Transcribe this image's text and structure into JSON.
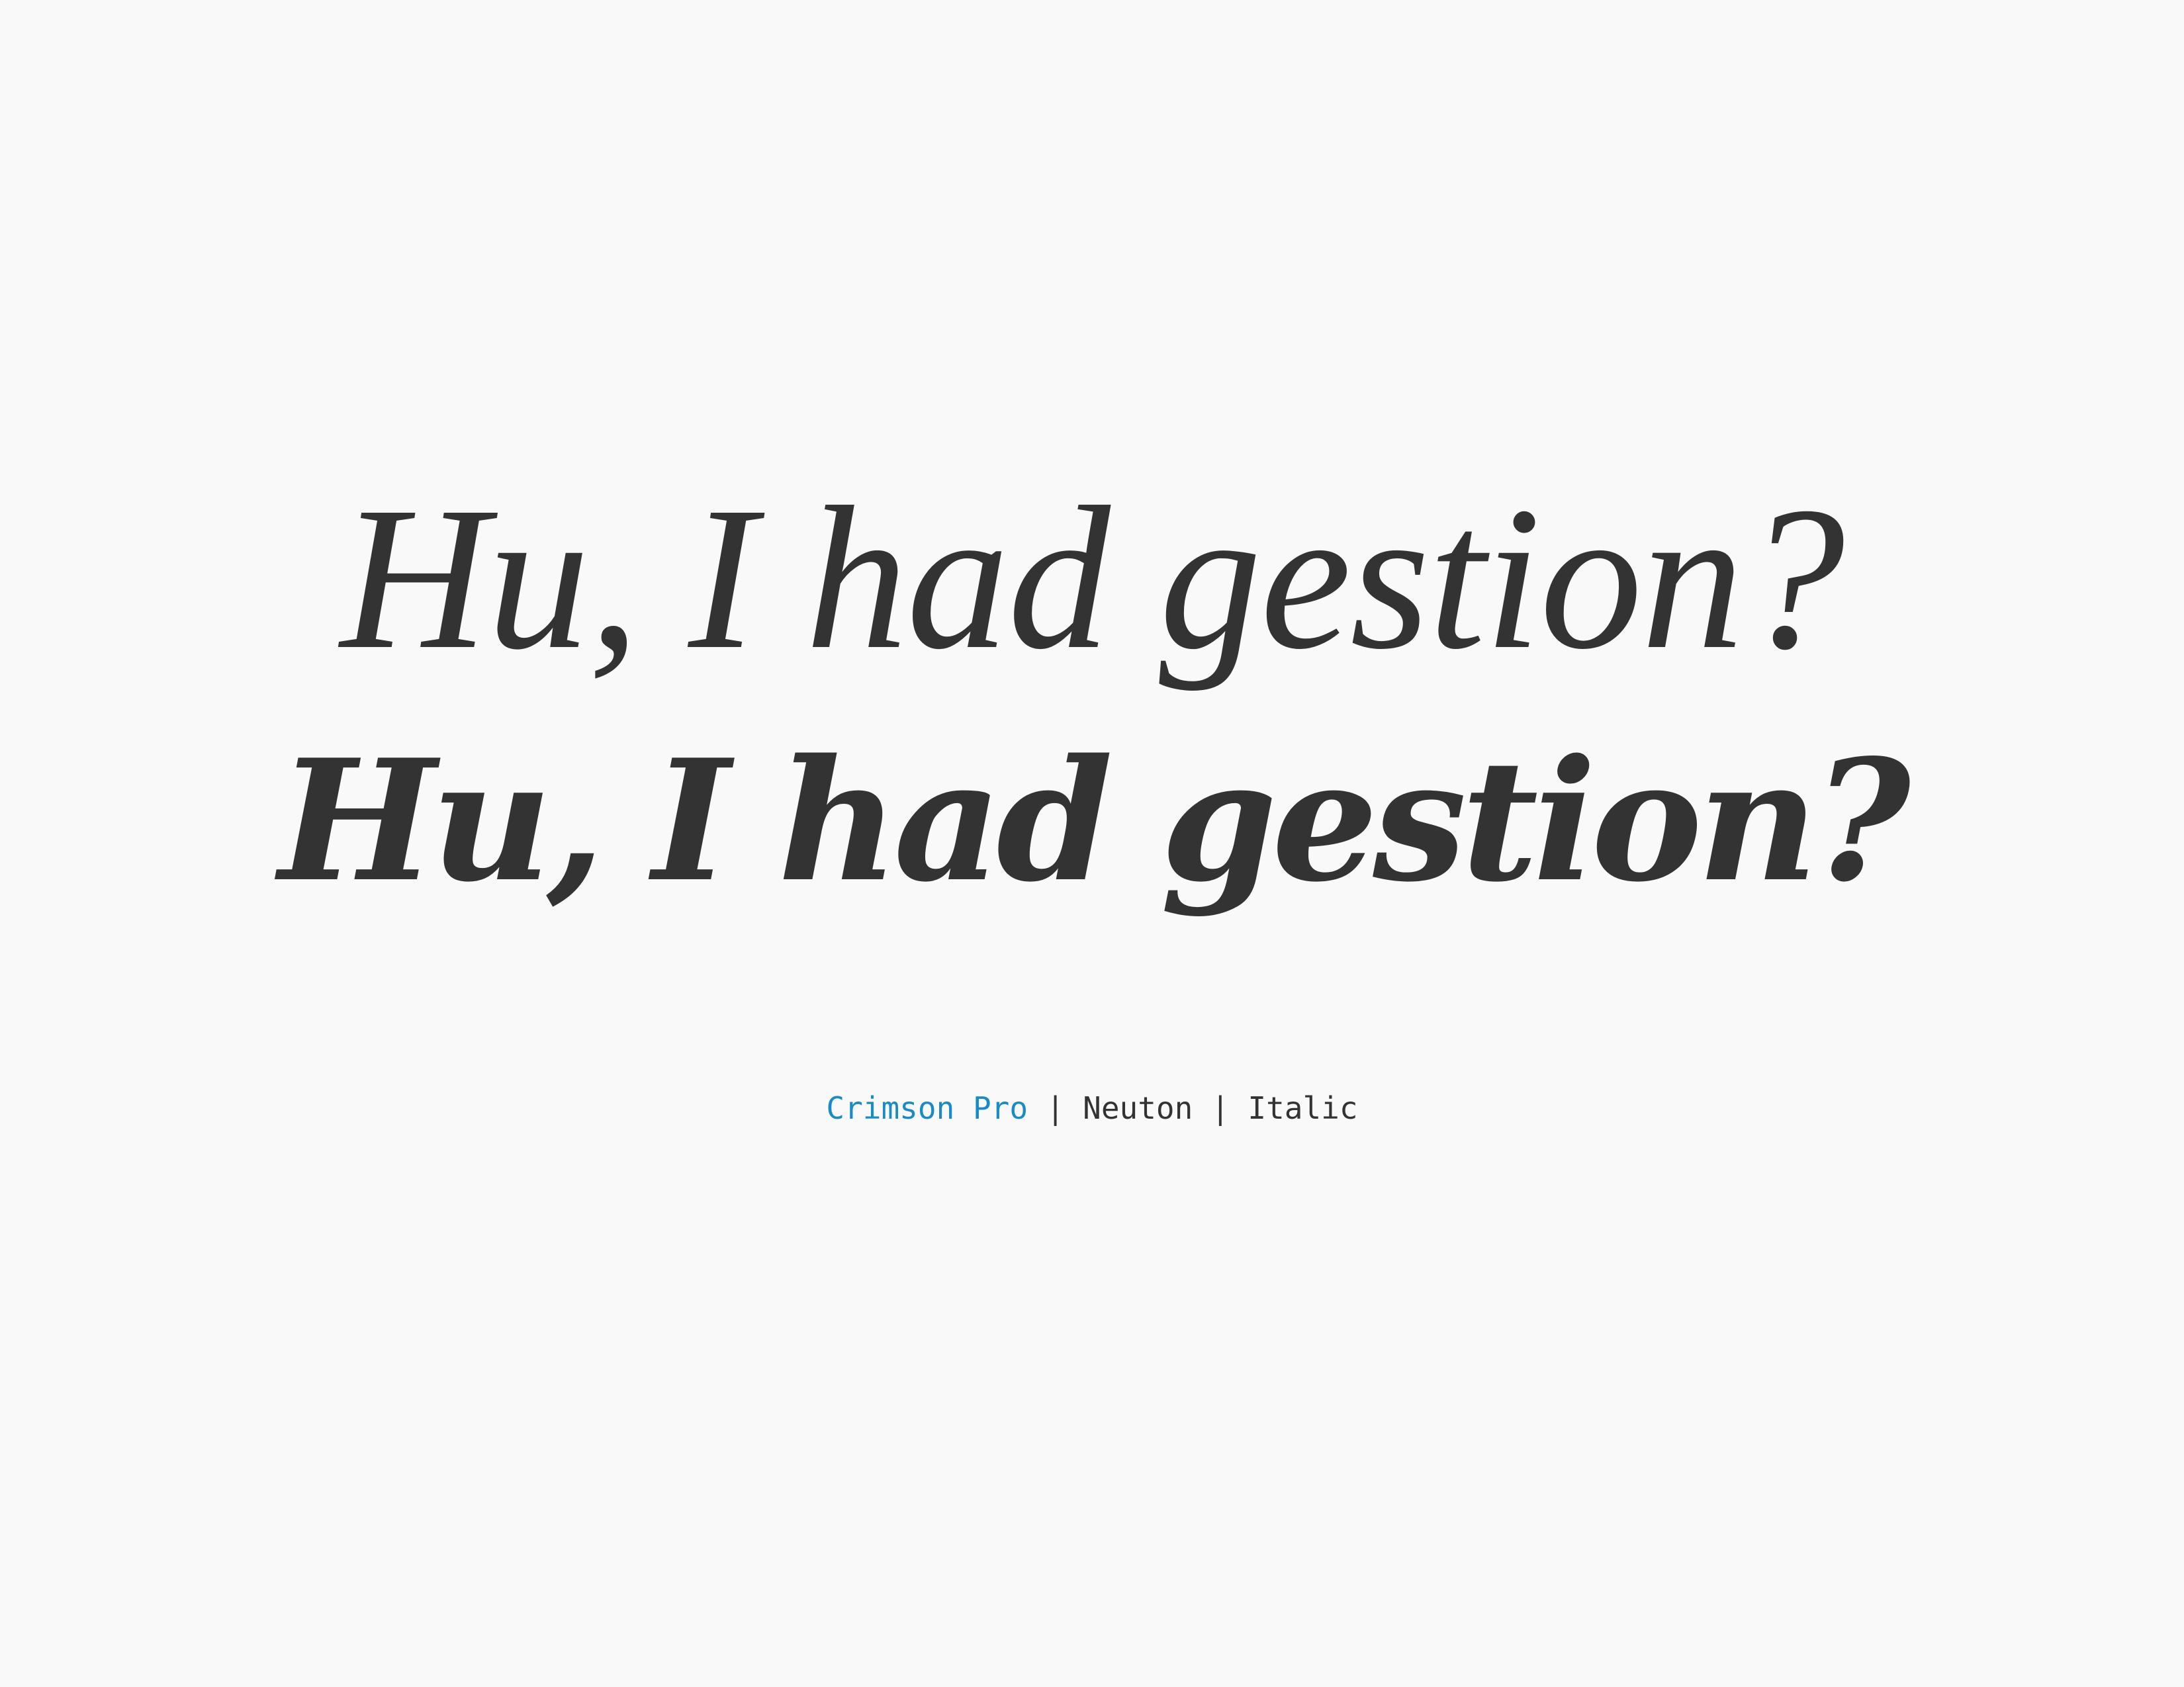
{
  "specimen": {
    "line_1": "Hu, I had gestion?",
    "line_2": "Hu, I had gestion?"
  },
  "caption": {
    "font_a": "Crimson Pro",
    "separator_1": " | ",
    "font_b": "Neuton",
    "separator_2": " | ",
    "style": "Italic"
  },
  "colors": {
    "background": "#f9f9f9",
    "text": "#333333",
    "accent": "#1a8bc4"
  }
}
